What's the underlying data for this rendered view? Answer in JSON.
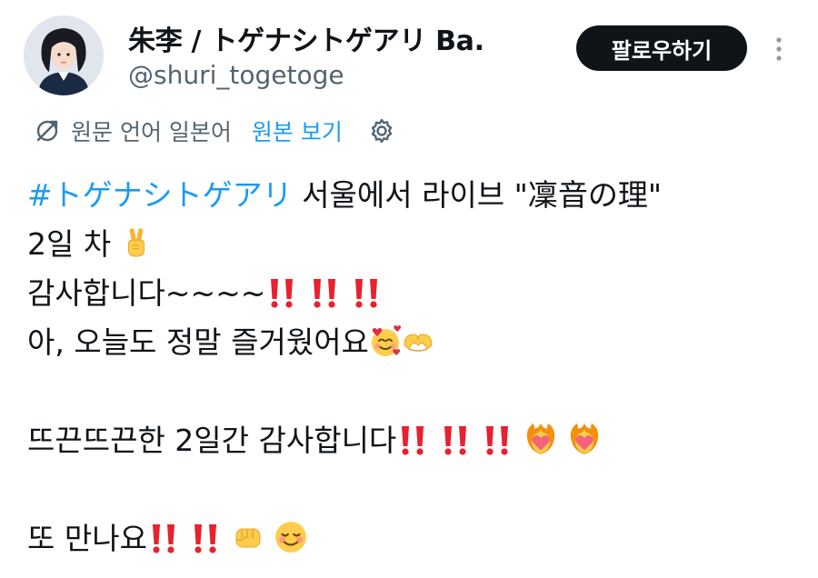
{
  "user": {
    "display_name": "朱李 / トゲナシトゲアリ Ba.",
    "handle": "@shuri_togetoge"
  },
  "actions": {
    "follow_label": "팔로우하기",
    "more_icon": "more-vertical-icon"
  },
  "translation": {
    "icon": "translate-icon",
    "original_language": "원문 언어 일본어",
    "view_original_label": "원본 보기",
    "settings_icon": "gear-icon"
  },
  "tweet": {
    "hashtag": "#トゲナシトゲアリ",
    "line1_rest": " 서울에서 라이브 \"凜音の理\"",
    "line2": "2일 차",
    "line3": "감사합니다~~~~",
    "line4": "아, 오늘도 정말 즐거웠어요",
    "line6": "뜨끈뜨끈한 2일간 감사합니다",
    "line8": "또 만나요"
  },
  "emojis": {
    "victory": "victory-hand-emoji",
    "double_exclamation": "double-exclamation-emoji",
    "smiling_hearts": "smiling-face-with-hearts-emoji",
    "heart_hands": "heart-hands-emoji",
    "heart_on_fire": "heart-on-fire-emoji",
    "oncoming_fist": "oncoming-fist-emoji",
    "relaxed": "smiling-face-emoji"
  },
  "colors": {
    "link": "#1d9bf0",
    "text": "#0f1419",
    "secondary": "#536471",
    "button_bg": "#0f1419",
    "exclamation_red": "#e8212f"
  }
}
